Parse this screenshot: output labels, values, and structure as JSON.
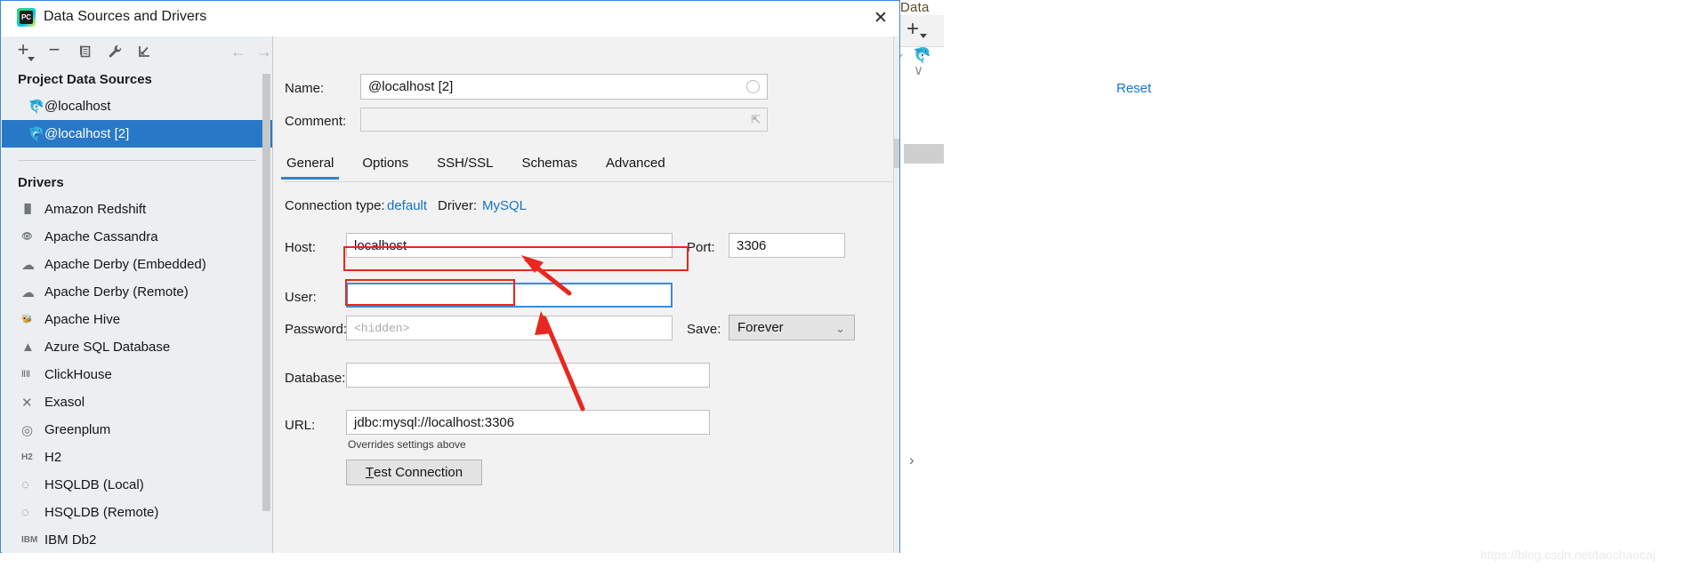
{
  "dialog": {
    "title": "Data Sources and Drivers",
    "app_icon_text": "PC",
    "close_icon": "close-icon",
    "reset_label": "Reset"
  },
  "left_toolbar": {
    "add_icon": "plus-icon",
    "add_label": "+",
    "remove_label": "−",
    "copy_icon": "copy-icon",
    "copy_label": "⎘",
    "wrench_icon": "wrench-icon",
    "wrench_label": "🔧",
    "import_icon": "import-icon",
    "import_label": "⤘",
    "back_label": "←",
    "forward_label": "→"
  },
  "tree": {
    "project_section": "Project Data Sources",
    "drivers_section": "Drivers",
    "data_sources": [
      {
        "label": "@localhost",
        "icon": "mysql-dolphin-icon",
        "glyph": "🐬",
        "selected": false
      },
      {
        "label": "@localhost [2]",
        "icon": "mysql-dolphin-icon",
        "glyph": "🐬",
        "selected": true
      }
    ],
    "drivers": [
      {
        "label": "Amazon Redshift",
        "icon": "amazon-redshift-icon",
        "glyph": "▐▌"
      },
      {
        "label": "Apache Cassandra",
        "icon": "apache-cassandra-icon",
        "glyph": "👁"
      },
      {
        "label": "Apache Derby (Embedded)",
        "icon": "apache-derby-icon",
        "glyph": "☁"
      },
      {
        "label": "Apache Derby (Remote)",
        "icon": "apache-derby-icon",
        "glyph": "☁"
      },
      {
        "label": "Apache Hive",
        "icon": "apache-hive-icon",
        "glyph": "🐝"
      },
      {
        "label": "Azure SQL Database",
        "icon": "azure-sql-icon",
        "glyph": "▲"
      },
      {
        "label": "ClickHouse",
        "icon": "clickhouse-icon",
        "glyph": "‖‖"
      },
      {
        "label": "Exasol",
        "icon": "exasol-icon",
        "glyph": "✕"
      },
      {
        "label": "Greenplum",
        "icon": "greenplum-icon",
        "glyph": "◎"
      },
      {
        "label": "H2",
        "icon": "h2-icon",
        "glyph": "H2"
      },
      {
        "label": "HSQLDB (Local)",
        "icon": "hsqldb-icon",
        "glyph": "◌"
      },
      {
        "label": "HSQLDB (Remote)",
        "icon": "hsqldb-icon",
        "glyph": "◌"
      },
      {
        "label": "IBM Db2",
        "icon": "ibm-db2-icon",
        "glyph": "IBM"
      }
    ]
  },
  "form": {
    "name_label": "Name:",
    "name_value": "@localhost [2]",
    "name_status_icon": "circle-status-icon",
    "comment_label": "Comment:",
    "comment_value": "",
    "comment_expand_icon": "expand-icon",
    "tabs": [
      {
        "label": "General",
        "active": true
      },
      {
        "label": "Options",
        "active": false
      },
      {
        "label": "SSH/SSL",
        "active": false
      },
      {
        "label": "Schemas",
        "active": false
      },
      {
        "label": "Advanced",
        "active": false
      }
    ],
    "connection_type_label": "Connection type:",
    "connection_type_value": "default",
    "driver_label": "Driver:",
    "driver_value": "MySQL",
    "host_label": "Host:",
    "host_value": "localhost",
    "port_label": "Port:",
    "port_value": "3306",
    "user_label": "User:",
    "user_value": "",
    "password_label": "Password:",
    "password_placeholder": "<hidden>",
    "save_label": "Save:",
    "save_value": "Forever",
    "save_caret_icon": "chevron-down-icon",
    "database_label": "Database:",
    "database_value": "",
    "url_label": "URL:",
    "url_value": "jdbc:mysql://localhost:3306",
    "url_hint": "Overrides settings above",
    "test_connection_mnemonic": "T",
    "test_connection_rest": "est Connection"
  },
  "background_app": {
    "title_fragment": "Data",
    "plus_icon": "plus-icon",
    "check_icon": "check-icon",
    "dolphin_icon": "mysql-dolphin-icon",
    "chevron_icon": "chevron-down-icon",
    "arrow_icon": "chevron-right-icon",
    "plus_label": "+",
    "check_label": "✓",
    "dolphin_label": "🐬",
    "chevron_label": "∨",
    "arrow_label": "›"
  },
  "annotations": {
    "accent_red": "#e8271f",
    "focus_blue": "#3c8ad9",
    "link_blue": "#1573c8",
    "selection_blue": "#2878c8",
    "watermark": "https://blog.csdn.net/taochaocaj"
  }
}
